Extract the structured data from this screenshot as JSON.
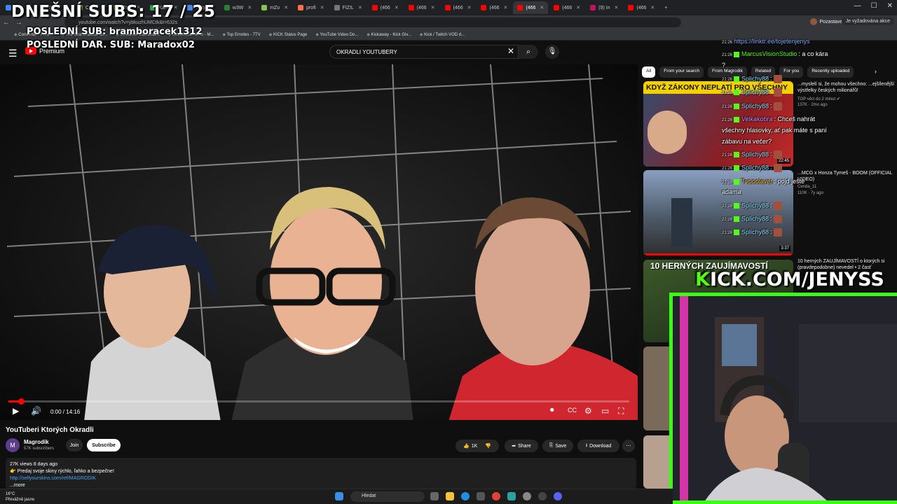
{
  "browser": {
    "tabs": [
      "",
      "Betfi",
      "Ctrlv",
      "Ctrlv",
      "Kawi",
      "Nagi",
      "w3W",
      "mZo",
      "profi",
      "FIZIL",
      "(466",
      "(466",
      "(466",
      "(466",
      "(466",
      "(466",
      "(9) In",
      "(466"
    ],
    "active_tab_index": 14,
    "url": "youtube.com/watch?v=ybkuzhUMCtk&t=632s",
    "profile_label": "Pozastaveno",
    "verify_label": "Je vyžadována akce",
    "bookmarks": [
      "Converter - Free...",
      "The best ChatBot an...",
      "Streamer Dashboard",
      "StreamElements - M...",
      "Top Emotes - 7TV",
      "KICK Status Page",
      "YouTube Video Do...",
      "Kickaway - Kick Giv...",
      "Kick / Twitch VOD d..."
    ]
  },
  "youtube": {
    "logo_label": "Premium",
    "search_query": "OKRADLI YOUTUBERY",
    "video": {
      "time": "0:00 / 14:16",
      "progress_fraction": 0.02,
      "title": "YouTuberi Ktorých Okradli",
      "channel": "Magrodik",
      "subscribers": "57K subscribers",
      "join_label": "Join",
      "subscribe_label": "Subscribe",
      "like_label": "1K",
      "share_label": "Share",
      "save_label": "Save",
      "download_label": "Download",
      "desc_meta": "27K views  8 days ago",
      "desc_line1": "👉 Predaj svoje skiny rýchlo, ľahko a bezpečne!",
      "desc_link": "http://sellyourskins.com/ref/MAGRODIK",
      "desc_more": "...more"
    },
    "chips": [
      "All",
      "From your search",
      "From Magrodik",
      "Related",
      "For you",
      "Recently uploaded"
    ],
    "recommendations": [
      {
        "thumb_text": "KDYŽ ZÁKONY NEPLATÍ PRO VŠECHNY",
        "title": "...myslelí si, že mohou všechno: ...ejšílenější výstřelky českých milionářů!",
        "channel": "TOP věci do 2 minut ✔",
        "meta": "137K · 2mo ago",
        "duration": "22:45"
      },
      {
        "title": "...MCG x Honza Tymeš - BOOM (OFFICIAL VIDEO)",
        "channel": "Cenda_11",
        "meta": "110K · 7y ago",
        "duration": "3:37"
      },
      {
        "thumb_text": "10 HERNÝCH ZAUJÍMAVOSTÍ",
        "title": "10 herných ZAUJÍMAVOSTÍ o ktorých si (pravdepodobne) nevedel • 2 časť",
        "channel": "",
        "meta": ""
      }
    ]
  },
  "chat": [
    {
      "time": "21:26",
      "user": "",
      "text": "https://linktr.ee/tojetenjenys",
      "color": "#7fa9ff"
    },
    {
      "time": "21:26",
      "user": "MarcusVisionStudio",
      "text": ": a co kára",
      "color": "#53fc18"
    },
    {
      "time": "",
      "user": "",
      "text": "?",
      "color": "#ffffff"
    },
    {
      "time": "21:26",
      "user": "Splichy88",
      "text": ":",
      "color": "#8fe0ff"
    },
    {
      "time": "21:26",
      "user": "Splichy88",
      "text": ":",
      "color": "#8fe0ff"
    },
    {
      "time": "21:26",
      "user": "Splichy88",
      "text": ":",
      "color": "#8fe0ff"
    },
    {
      "time": "21:26",
      "user": "Velkakobra",
      "text": ": Chceš nahrát",
      "color": "#c98cff"
    },
    {
      "time": "",
      "user": "",
      "text": "všechny hlasovky, ať pak máte s paní",
      "color": "#ffffff"
    },
    {
      "time": "",
      "user": "",
      "text": "zábavu na večer?",
      "color": "#ffffff"
    },
    {
      "time": "21:26",
      "user": "Splichy88",
      "text": ":",
      "color": "#8fe0ff"
    },
    {
      "time": "21:26",
      "user": "Splichy88",
      "text": ":",
      "color": "#8fe0ff"
    },
    {
      "time": "21:26",
      "user": "Tvooolaver",
      "text": ": pojd ještě",
      "color": "#ffb020"
    },
    {
      "time": "",
      "user": "",
      "text": "adama",
      "color": "#ffffff"
    },
    {
      "time": "21:26",
      "user": "Splichy88",
      "text": ":",
      "color": "#8fe0ff"
    },
    {
      "time": "21:26",
      "user": "Splichy88",
      "text": ":",
      "color": "#8fe0ff"
    },
    {
      "time": "21:26",
      "user": "Splichy88",
      "text": ":",
      "color": "#8fe0ff"
    }
  ],
  "overlay": {
    "subs_line": "DNEŠNÍ SUBS: 17 / 25",
    "last_sub": "POSLEDNÍ SUB: bramboracek1312",
    "last_donation": "POSLEDNÍ DAR. SUB: Maradox02",
    "kick_url": "KICK.COM/JENYSS"
  },
  "taskbar": {
    "temp": "16°C",
    "weather": "Převážně jasno",
    "search_label": "Hledat"
  },
  "colors": {
    "kick_green": "#53fc18",
    "yt_red": "#ff0000",
    "webcam_border": "#39ff14"
  }
}
